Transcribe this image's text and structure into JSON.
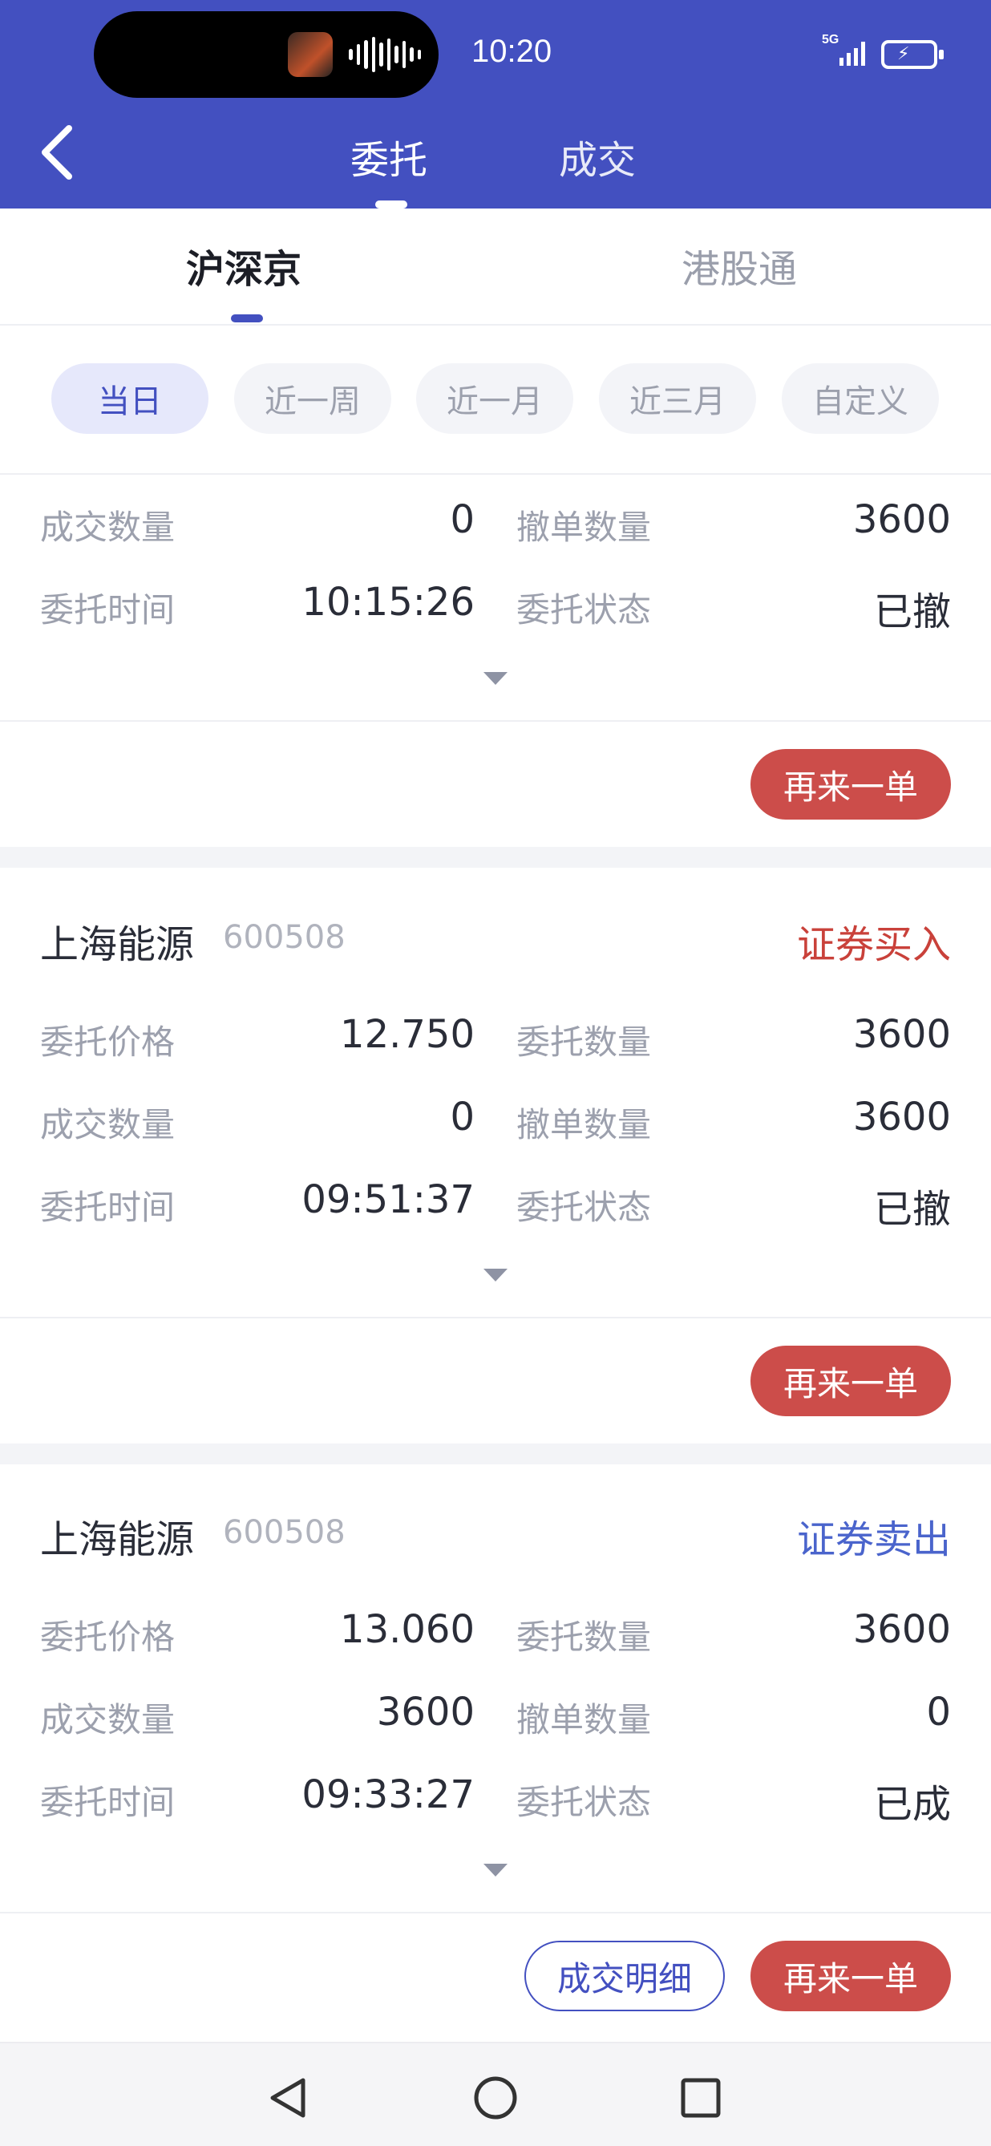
{
  "status_bar": {
    "time": "10:20",
    "network": "5G"
  },
  "header": {
    "tabs": [
      {
        "label": "委托"
      },
      {
        "label": "成交"
      }
    ]
  },
  "market_tabs": [
    {
      "label": "沪深京"
    },
    {
      "label": "港股通"
    }
  ],
  "filters": [
    {
      "label": "当日"
    },
    {
      "label": "近一周"
    },
    {
      "label": "近一月"
    },
    {
      "label": "近三月"
    },
    {
      "label": "自定义"
    }
  ],
  "orders": [
    {
      "rows": [
        {
          "left_label": "成交数量",
          "left_value": "0",
          "right_label": "撤单数量",
          "right_value": "3600"
        },
        {
          "left_label": "委托时间",
          "left_value": "10:15:26",
          "right_label": "委托状态",
          "right_value": "已撤"
        }
      ],
      "reorder_label": "再来一单"
    },
    {
      "name": "上海能源",
      "code": "600508",
      "side": "证券买入",
      "side_color": "#c9413a",
      "rows": [
        {
          "left_label": "委托价格",
          "left_value": "12.750",
          "right_label": "委托数量",
          "right_value": "3600"
        },
        {
          "left_label": "成交数量",
          "left_value": "0",
          "right_label": "撤单数量",
          "right_value": "3600"
        },
        {
          "left_label": "委托时间",
          "left_value": "09:51:37",
          "right_label": "委托状态",
          "right_value": "已撤"
        }
      ],
      "reorder_label": "再来一单"
    },
    {
      "name": "上海能源",
      "code": "600508",
      "side": "证券卖出",
      "side_color": "#4a64cc",
      "rows": [
        {
          "left_label": "委托价格",
          "left_value": "13.060",
          "right_label": "委托数量",
          "right_value": "3600"
        },
        {
          "left_label": "成交数量",
          "left_value": "3600",
          "right_label": "撤单数量",
          "right_value": "0"
        },
        {
          "left_label": "委托时间",
          "left_value": "09:33:27",
          "right_label": "委托状态",
          "right_value": "已成"
        }
      ],
      "detail_label": "成交明细",
      "reorder_label": "再来一单"
    }
  ],
  "colors": {
    "primary": "#4350c0",
    "buy": "#c9413a",
    "sell": "#4a64cc",
    "reorder_button": "#cc4d4a"
  }
}
